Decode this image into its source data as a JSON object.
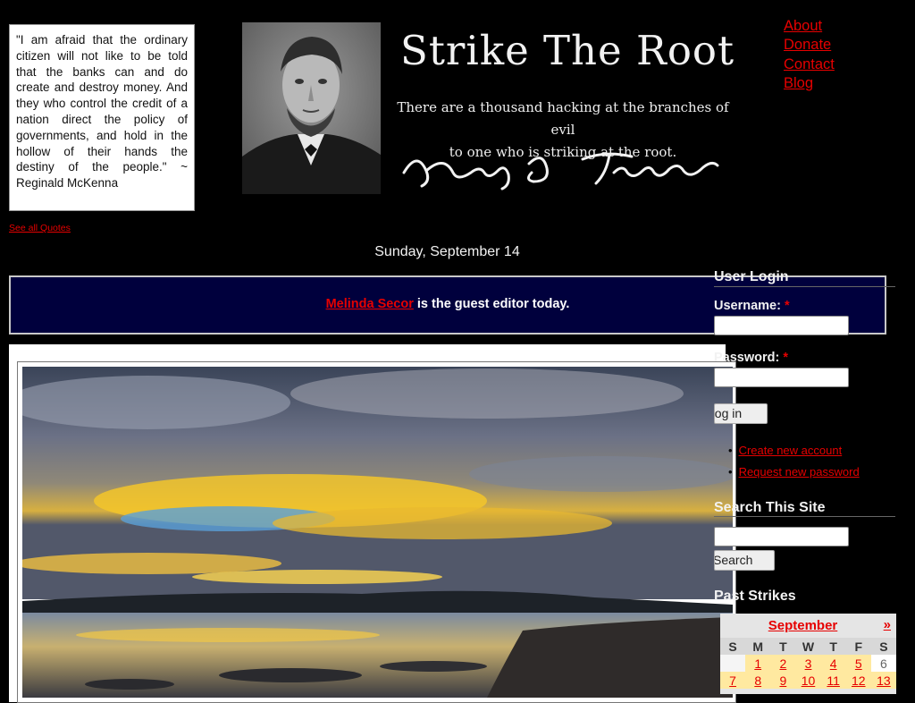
{
  "quote": {
    "text": "\"I am afraid that the ordinary citizen will not like to be told that the banks can and do create and destroy money. And they who control the credit of a nation direct the policy of governments, and hold in the hollow of their hands the destiny of the people.\" ~ Reginald McKenna",
    "see_all": "See all Quotes"
  },
  "header": {
    "site_title": "Strike The Root",
    "tagline_1": "There are a thousand hacking at the branches of evil",
    "tagline_2": "to one who is striking at the root.",
    "signature": "Henry D. Thoreau"
  },
  "top_links": [
    "About",
    "Donate",
    "Contact",
    "Blog"
  ],
  "date_line": "Sunday, September 14",
  "banner": {
    "editor_name": "Melinda Secor",
    "text": " is the guest editor today."
  },
  "login": {
    "title": "User Login",
    "username_label": "Username:",
    "password_label": "Password:",
    "required": "*",
    "button": "Log in",
    "create_account": "Create new account",
    "request_password": "Request new password"
  },
  "search": {
    "title": "Search This Site",
    "button": "Search"
  },
  "strikes": {
    "title": "Past Strikes",
    "month": "September",
    "next": "»",
    "weekdays": [
      "S",
      "M",
      "T",
      "W",
      "T",
      "F",
      "S"
    ],
    "week1": [
      "",
      "1",
      "2",
      "3",
      "4",
      "5",
      "6"
    ],
    "week2": [
      "7",
      "8",
      "9",
      "10",
      "11",
      "12",
      "13"
    ]
  }
}
